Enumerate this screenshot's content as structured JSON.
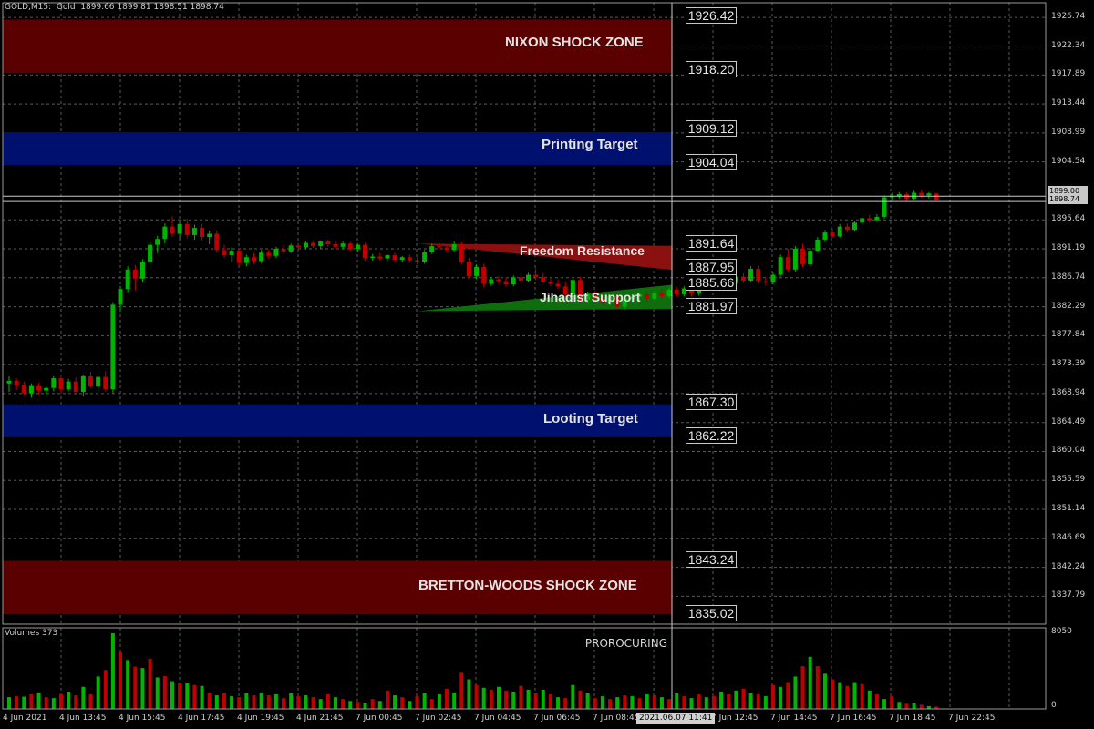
{
  "header": {
    "symbol": "GOLD",
    "timeframe": "M15",
    "description": "Gold",
    "open": "1899.66",
    "high": "1899.81",
    "low": "1898.51",
    "close": "1898.74"
  },
  "colors": {
    "background": "#000000",
    "grid": "#5a5a5a",
    "bull": "#00b400",
    "bear": "#c00000",
    "shock_zone": "#5a0000",
    "target_zone": "#00106e",
    "resistance": "#8b1010",
    "support": "#0e6e0e"
  },
  "zones": [
    {
      "label": "NIXON SHOCK ZONE",
      "top": "1926.42",
      "bottom": "1918.20",
      "type": "shock"
    },
    {
      "label": "Printing Target",
      "top": "1909.12",
      "bottom": "1904.04",
      "type": "target"
    },
    {
      "label": "Looting Target",
      "top": "1867.30",
      "bottom": "1862.22",
      "type": "target"
    },
    {
      "label": "BRETTON-WOODS SHOCK ZONE",
      "top": "1843.24",
      "bottom": "1835.02",
      "type": "shock"
    }
  ],
  "wedges": [
    {
      "label": "Freedom Resistance",
      "upper": "1891.64",
      "lower": "1887.95"
    },
    {
      "label": "Jihadist Support",
      "upper": "1885.66",
      "lower": "1881.97"
    }
  ],
  "price_axis": [
    "1926.74",
    "1922.34",
    "1917.89",
    "1913.44",
    "1908.99",
    "1904.54",
    "1895.64",
    "1891.19",
    "1886.74",
    "1882.29",
    "1877.84",
    "1873.39",
    "1868.94",
    "1864.49",
    "1860.04",
    "1855.59",
    "1851.14",
    "1846.69",
    "1842.24",
    "1837.79"
  ],
  "current_price": {
    "bid": "1899.00",
    "last": "1898.74"
  },
  "time_axis": [
    "4 Jun 2021",
    "4 Jun 13:45",
    "4 Jun 15:45",
    "4 Jun 17:45",
    "4 Jun 19:45",
    "4 Jun 21:45",
    "7 Jun 00:45",
    "7 Jun 02:45",
    "7 Jun 04:45",
    "7 Jun 06:45",
    "7 Jun 08:45",
    "7 Jun 12:45",
    "7 Jun 14:45",
    "7 Jun 16:45",
    "7 Jun 18:45",
    "7 Jun 22:45"
  ],
  "cursor_time": "2021.06.07 11:41",
  "volumes": {
    "label": "Volumes 373",
    "max_tick": "8050",
    "min_tick": "0"
  },
  "credit": "PROROCURING",
  "chart_data": {
    "type": "candlestick",
    "ylim": [
      1833.5,
      1929.0
    ],
    "candles": [
      [
        1870.5,
        1871.6,
        1869.2,
        1870.9
      ],
      [
        1870.9,
        1871.3,
        1869.5,
        1870.2
      ],
      [
        1870.2,
        1870.8,
        1868.6,
        1869.0
      ],
      [
        1869.0,
        1870.5,
        1868.3,
        1870.1
      ],
      [
        1870.1,
        1870.6,
        1868.8,
        1869.4
      ],
      [
        1869.4,
        1870.0,
        1868.7,
        1869.8
      ],
      [
        1869.8,
        1871.6,
        1869.3,
        1871.3
      ],
      [
        1871.3,
        1871.8,
        1869.0,
        1869.6
      ],
      [
        1869.6,
        1871.2,
        1869.3,
        1870.8
      ],
      [
        1870.8,
        1871.4,
        1868.8,
        1869.2
      ],
      [
        1869.2,
        1871.8,
        1868.5,
        1871.6
      ],
      [
        1871.6,
        1872.3,
        1869.8,
        1870.0
      ],
      [
        1870.0,
        1872.0,
        1869.1,
        1871.5
      ],
      [
        1871.5,
        1872.4,
        1869.2,
        1869.6
      ],
      [
        1869.6,
        1883.0,
        1869.0,
        1882.6
      ],
      [
        1882.6,
        1885.5,
        1881.5,
        1885.0
      ],
      [
        1885.0,
        1888.5,
        1884.5,
        1888.0
      ],
      [
        1888.0,
        1888.7,
        1884.8,
        1886.6
      ],
      [
        1886.6,
        1889.6,
        1886.0,
        1889.2
      ],
      [
        1889.2,
        1892.2,
        1888.8,
        1891.8
      ],
      [
        1891.8,
        1893.2,
        1890.5,
        1892.7
      ],
      [
        1892.7,
        1895.1,
        1892.0,
        1894.6
      ],
      [
        1894.6,
        1896.2,
        1893.0,
        1893.5
      ],
      [
        1893.5,
        1895.5,
        1892.6,
        1895.0
      ],
      [
        1895.0,
        1895.8,
        1892.8,
        1893.3
      ],
      [
        1893.3,
        1894.9,
        1892.6,
        1894.4
      ],
      [
        1894.4,
        1895.0,
        1892.5,
        1893.0
      ],
      [
        1893.0,
        1894.0,
        1891.9,
        1893.5
      ],
      [
        1893.5,
        1894.0,
        1890.6,
        1891.0
      ],
      [
        1891.0,
        1891.8,
        1889.8,
        1890.2
      ],
      [
        1890.2,
        1891.4,
        1889.2,
        1890.9
      ],
      [
        1890.9,
        1891.3,
        1888.6,
        1889.0
      ],
      [
        1889.0,
        1890.3,
        1888.5,
        1889.9
      ],
      [
        1889.9,
        1890.5,
        1888.9,
        1889.3
      ],
      [
        1889.3,
        1891.0,
        1889.0,
        1890.6
      ],
      [
        1890.6,
        1891.1,
        1889.6,
        1890.1
      ],
      [
        1890.1,
        1891.5,
        1889.8,
        1891.2
      ],
      [
        1891.2,
        1891.8,
        1890.4,
        1890.8
      ],
      [
        1890.8,
        1892.0,
        1890.5,
        1891.7
      ],
      [
        1891.7,
        1892.1,
        1891.0,
        1891.4
      ],
      [
        1891.4,
        1892.4,
        1891.1,
        1892.1
      ],
      [
        1892.1,
        1892.5,
        1891.3,
        1891.6
      ],
      [
        1891.6,
        1892.5,
        1891.2,
        1892.3
      ],
      [
        1892.3,
        1892.6,
        1891.5,
        1891.9
      ],
      [
        1891.9,
        1892.4,
        1891.2,
        1891.5
      ],
      [
        1891.5,
        1892.3,
        1891.1,
        1892.0
      ],
      [
        1892.0,
        1892.2,
        1890.9,
        1891.2
      ],
      [
        1891.2,
        1892.0,
        1890.8,
        1891.8
      ],
      [
        1891.8,
        1892.1,
        1889.4,
        1889.8
      ],
      [
        1889.8,
        1890.4,
        1889.4,
        1890.0
      ],
      [
        1890.0,
        1890.5,
        1889.4,
        1889.7
      ],
      [
        1889.7,
        1890.4,
        1889.3,
        1890.2
      ],
      [
        1890.2,
        1890.6,
        1889.2,
        1889.5
      ],
      [
        1889.5,
        1890.1,
        1889.1,
        1889.9
      ],
      [
        1889.9,
        1890.3,
        1889.0,
        1889.4
      ],
      [
        1889.4,
        1889.9,
        1888.8,
        1889.2
      ],
      [
        1889.2,
        1891.0,
        1888.9,
        1890.7
      ],
      [
        1890.7,
        1892.0,
        1890.4,
        1891.6
      ],
      [
        1891.6,
        1892.1,
        1891.1,
        1891.4
      ],
      [
        1891.4,
        1891.9,
        1890.6,
        1891.0
      ],
      [
        1891.0,
        1892.3,
        1890.7,
        1891.9
      ],
      [
        1891.9,
        1892.2,
        1888.8,
        1889.2
      ],
      [
        1889.2,
        1889.8,
        1886.6,
        1887.0
      ],
      [
        1887.0,
        1888.8,
        1886.5,
        1888.4
      ],
      [
        1888.4,
        1888.9,
        1885.3,
        1885.8
      ],
      [
        1885.8,
        1886.9,
        1885.5,
        1886.5
      ],
      [
        1886.5,
        1887.0,
        1885.8,
        1886.2
      ],
      [
        1886.2,
        1886.8,
        1885.3,
        1885.7
      ],
      [
        1885.7,
        1887.1,
        1885.4,
        1886.8
      ],
      [
        1886.8,
        1887.4,
        1885.9,
        1886.3
      ],
      [
        1886.3,
        1887.5,
        1886.0,
        1887.2
      ],
      [
        1887.2,
        1888.2,
        1886.4,
        1886.8
      ],
      [
        1886.8,
        1887.5,
        1885.9,
        1886.1
      ],
      [
        1886.1,
        1886.6,
        1885.4,
        1885.8
      ],
      [
        1885.8,
        1886.5,
        1885.0,
        1885.4
      ],
      [
        1885.4,
        1886.1,
        1883.7,
        1884.2
      ],
      [
        1884.2,
        1886.6,
        1883.8,
        1886.4
      ],
      [
        1886.4,
        1886.9,
        1883.0,
        1883.4
      ],
      [
        1883.4,
        1884.6,
        1882.9,
        1884.2
      ],
      [
        1884.2,
        1884.8,
        1883.2,
        1883.6
      ],
      [
        1883.6,
        1884.3,
        1882.6,
        1883.0
      ],
      [
        1883.0,
        1884.2,
        1882.5,
        1883.8
      ],
      [
        1883.8,
        1884.4,
        1881.8,
        1882.3
      ],
      [
        1882.3,
        1883.8,
        1882.0,
        1883.5
      ],
      [
        1883.5,
        1884.2,
        1883.0,
        1883.8
      ],
      [
        1883.8,
        1884.5,
        1883.2,
        1884.2
      ],
      [
        1884.2,
        1884.8,
        1883.1,
        1883.5
      ],
      [
        1883.5,
        1884.7,
        1883.2,
        1884.4
      ],
      [
        1884.4,
        1885.0,
        1883.5,
        1883.9
      ],
      [
        1883.9,
        1885.2,
        1883.6,
        1884.9
      ],
      [
        1884.9,
        1885.3,
        1883.8,
        1884.2
      ],
      [
        1884.2,
        1885.4,
        1883.9,
        1885.1
      ],
      [
        1885.1,
        1885.6,
        1883.9,
        1884.3
      ],
      [
        1884.3,
        1885.8,
        1884.0,
        1885.5
      ],
      [
        1885.5,
        1886.2,
        1884.9,
        1885.9
      ],
      [
        1885.9,
        1886.5,
        1885.0,
        1885.3
      ],
      [
        1885.3,
        1886.8,
        1885.0,
        1886.4
      ],
      [
        1886.4,
        1887.0,
        1885.5,
        1885.9
      ],
      [
        1885.9,
        1887.3,
        1885.6,
        1886.9
      ],
      [
        1886.9,
        1887.4,
        1885.9,
        1886.3
      ],
      [
        1886.3,
        1888.5,
        1886.0,
        1888.1
      ],
      [
        1888.1,
        1888.6,
        1885.8,
        1886.2
      ],
      [
        1886.2,
        1886.9,
        1885.5,
        1886.0
      ],
      [
        1886.0,
        1887.5,
        1885.7,
        1887.2
      ],
      [
        1887.2,
        1890.3,
        1886.9,
        1889.9
      ],
      [
        1889.9,
        1891.2,
        1887.6,
        1888.0
      ],
      [
        1888.0,
        1891.6,
        1887.7,
        1891.2
      ],
      [
        1891.2,
        1892.0,
        1888.4,
        1888.8
      ],
      [
        1888.8,
        1891.3,
        1888.5,
        1890.9
      ],
      [
        1890.9,
        1893.0,
        1890.6,
        1892.6
      ],
      [
        1892.6,
        1894.1,
        1892.2,
        1893.7
      ],
      [
        1893.7,
        1894.3,
        1892.8,
        1893.1
      ],
      [
        1893.1,
        1895.0,
        1892.9,
        1894.6
      ],
      [
        1894.6,
        1895.1,
        1893.7,
        1894.1
      ],
      [
        1894.1,
        1895.5,
        1893.8,
        1895.2
      ],
      [
        1895.2,
        1896.3,
        1894.9,
        1895.9
      ],
      [
        1895.9,
        1896.4,
        1895.2,
        1895.6
      ],
      [
        1895.6,
        1896.5,
        1895.3,
        1896.1
      ],
      [
        1896.1,
        1899.4,
        1895.8,
        1899.1
      ],
      [
        1899.1,
        1899.8,
        1898.6,
        1899.3
      ],
      [
        1899.3,
        1899.9,
        1898.9,
        1899.6
      ],
      [
        1899.6,
        1899.9,
        1898.5,
        1898.9
      ],
      [
        1898.9,
        1900.1,
        1898.7,
        1899.8
      ],
      [
        1899.8,
        1900.2,
        1899.1,
        1899.4
      ],
      [
        1899.4,
        1899.9,
        1898.9,
        1899.7
      ],
      [
        1899.7,
        1899.8,
        1898.5,
        1898.74
      ]
    ],
    "volumes": [
      1250,
      1350,
      1300,
      1550,
      1750,
      1250,
      1150,
      1550,
      1850,
      1450,
      2350,
      1550,
      3450,
      4150,
      8050,
      6050,
      5200,
      4500,
      4350,
      5350,
      3350,
      3500,
      2950,
      2750,
      2750,
      2550,
      2450,
      1750,
      1450,
      1650,
      1350,
      1250,
      1650,
      1450,
      1750,
      1450,
      1550,
      1150,
      1650,
      1350,
      1450,
      1250,
      1050,
      1550,
      1250,
      1050,
      850,
      750,
      650,
      1050,
      850,
      1950,
      1450,
      1250,
      850,
      1350,
      1650,
      1050,
      1550,
      2150,
      1750,
      3950,
      3150,
      2550,
      2250,
      2050,
      2350,
      1950,
      1850,
      2450,
      2050,
      1650,
      2050,
      1550,
      1250,
      1150,
      2550,
      1950,
      1650,
      1150,
      1350,
      1050,
      1250,
      1450,
      1350,
      1150,
      1550,
      1450,
      1250,
      1050,
      1650,
      1350,
      1150,
      1550,
      1250,
      1350,
      1850,
      1550,
      1950,
      2150,
      1650,
      1550,
      1350,
      2550,
      2350,
      2850,
      3450,
      4550,
      5550,
      4550,
      3750,
      3150,
      2850,
      2450,
      2850,
      2650,
      1950,
      1550,
      1050,
      1350,
      750,
      550,
      650,
      450,
      300,
      250
    ]
  }
}
